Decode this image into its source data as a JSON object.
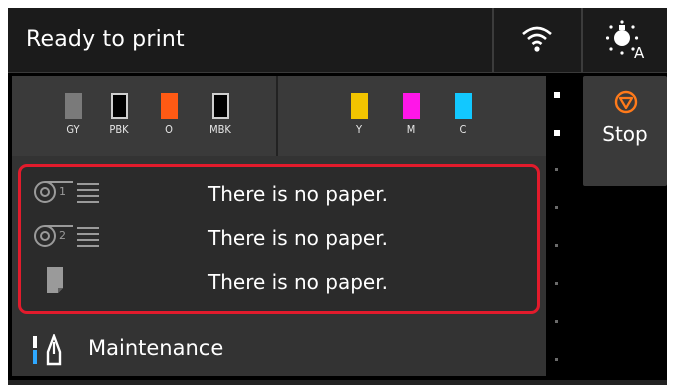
{
  "status": {
    "text": "Ready to print"
  },
  "icons": {
    "wifi": "wifi-icon",
    "light": "status-light-icon",
    "roll1": "roll-paper-1-icon",
    "roll2": "roll-paper-2-icon",
    "cut_sheet": "cut-sheet-icon",
    "maintenance": "maintenance-tools-icon",
    "stop": "stop-icon"
  },
  "inks": [
    {
      "label": "GY",
      "color": "#7a7a7a"
    },
    {
      "label": "PBK",
      "color": "#000000"
    },
    {
      "label": "O",
      "color": "#ff5a14"
    },
    {
      "label": "MBK",
      "color": "#000000"
    },
    {
      "label": "Y",
      "color": "#f2c400"
    },
    {
      "label": "M",
      "color": "#ff16e8"
    },
    {
      "label": "C",
      "color": "#12c8ff"
    }
  ],
  "paper": {
    "roll1_message": "There is no paper.",
    "roll2_message": "There is no paper.",
    "cut_sheet_message": "There is no paper."
  },
  "menu": {
    "maintenance_label": "Maintenance"
  },
  "stop": {
    "label": "Stop",
    "accent": "#ff7a1a"
  },
  "colors": {
    "highlight_border": "#e21b2c"
  }
}
